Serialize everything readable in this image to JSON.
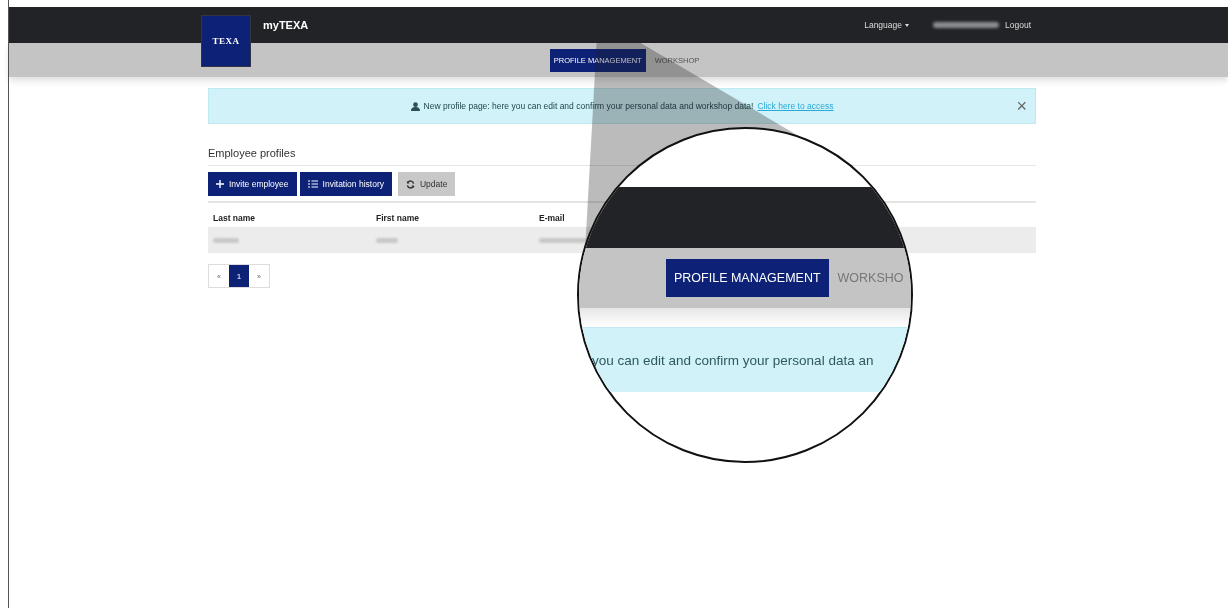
{
  "header": {
    "logo": "TEXA",
    "app_title": "myTEXA",
    "language_menu": "Language",
    "logout": "Logout"
  },
  "subnav": {
    "tabs": [
      {
        "label": "PROFILE MANAGEMENT",
        "selected": true
      },
      {
        "label": "WORKSHOP",
        "selected": false
      }
    ]
  },
  "alert": {
    "message": "New profile page: here you can edit and confirm your personal data and workshop data!",
    "link": "Click here to access",
    "close": "×"
  },
  "section_title": "Employee profiles",
  "toolbar": [
    {
      "label": "Invite employee",
      "kind": "primary"
    },
    {
      "label": "Invitation history",
      "kind": "primary"
    },
    {
      "label": "Update",
      "kind": "secondary"
    }
  ],
  "table": {
    "columns": [
      "Last name",
      "First name",
      "E-mail"
    ]
  },
  "pagination": {
    "prev": "«",
    "pages": [
      {
        "label": "1",
        "selected": true
      }
    ],
    "next": "»"
  },
  "magnifier": {
    "tabs": [
      {
        "label": "PROFILE MANAGEMENT",
        "selected": true
      },
      {
        "label": "WORKSHO",
        "selected": false
      }
    ],
    "alert_text": "you can edit and confirm your personal data an"
  }
}
